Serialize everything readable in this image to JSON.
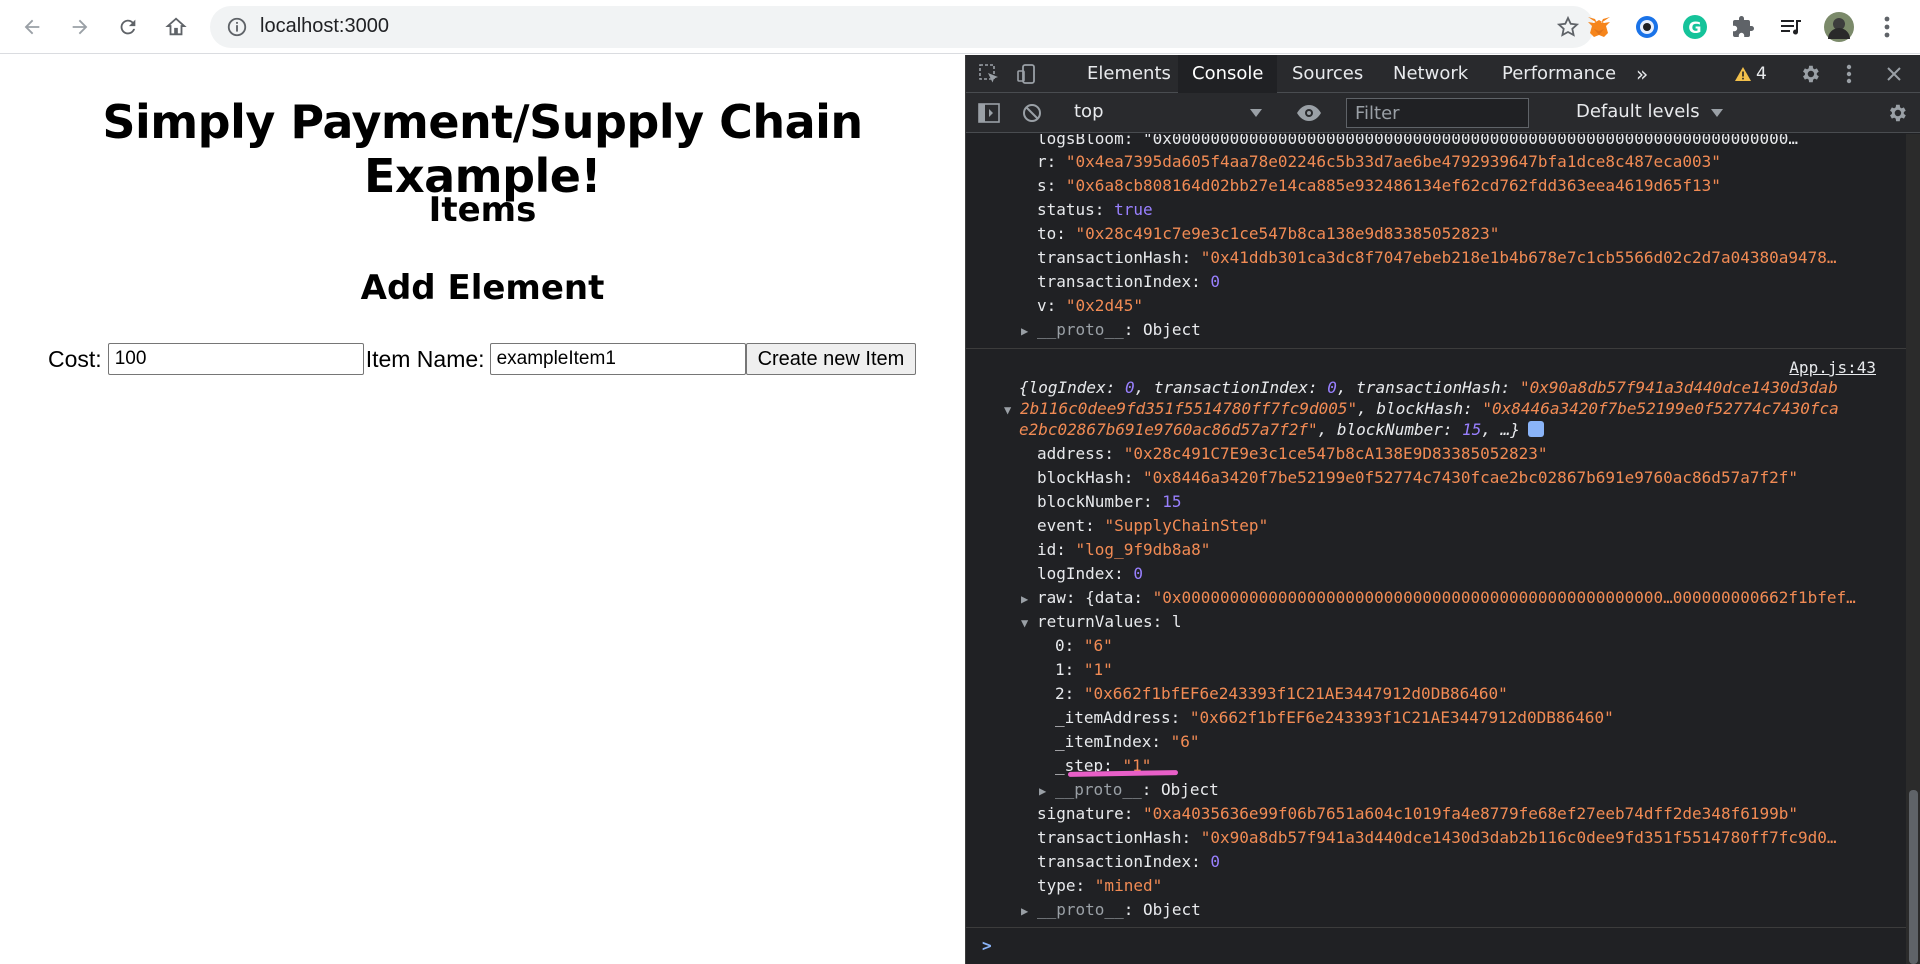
{
  "browser": {
    "url": "localhost:3000"
  },
  "page": {
    "title": "Simply Payment/Supply Chain Example!",
    "items_heading": "Items",
    "add_heading": "Add Element",
    "cost_label": "Cost:",
    "cost_value": "100",
    "item_name_label": "Item Name:",
    "item_name_value": "exampleItem1",
    "create_button": "Create new Item"
  },
  "devtools": {
    "tabs": [
      "Elements",
      "Console",
      "Sources",
      "Network",
      "Performance"
    ],
    "more_tabs": "»",
    "warning_count": "4",
    "context": "top",
    "filter_placeholder": "Filter",
    "levels": "Default levels",
    "source_link": "App.js:43",
    "prompt": ">"
  },
  "console": {
    "prev": {
      "logsBloom": "logsBloom: \"0x0000000000000000000000000000000000000000000000000000000000000000…",
      "r_key": "r: ",
      "r_val": "\"0x4ea7395da605f4aa78e02246c5b33d7ae6be4792939647bfa1dce8c487eca003\"",
      "s_key": "s: ",
      "s_val": "\"0x6a8cb808164d02bb27e14ca885e932486134ef62cd762fdd363eea4619d65f13\"",
      "status_key": "status: ",
      "status_val": "true",
      "to_key": "to: ",
      "to_val": "\"0x28c491c7e9e3c1ce547b8ca138e9d83385052823\"",
      "th_key": "transactionHash: ",
      "th_val": "\"0x41ddb301ca3dc8f7047ebeb218e1b4b678e7c1cb5566d02c2d7a04380a9478…",
      "ti_key": "transactionIndex: ",
      "ti_val": "0",
      "v_key": "v: ",
      "v_val": "\"0x2d45\"",
      "proto_key": "__proto__",
      "proto_val": ": Object"
    },
    "summary": {
      "l1_a": "{logIndex: ",
      "l1_b": "0",
      "l1_c": ", transactionIndex: ",
      "l1_d": "0",
      "l1_e": ", transactionHash: ",
      "l1_f": "\"0x90a8db57f941a3d440dce1430d3dab",
      "l2_a": "2b116c0dee9fd351f5514780ff7fc9d005\"",
      "l2_b": ", blockHash: ",
      "l2_c": "\"0x8446a3420f7be52199e0f52774c7430fca",
      "l3_a": "e2bc02867b691e9760ac86d57a7f2f\"",
      "l3_b": ", blockNumber: ",
      "l3_c": "15",
      "l3_d": ", …}"
    },
    "entry": {
      "address_key": "address: ",
      "address_val": "\"0x28c491C7E9e3c1ce547b8cA138E9D83385052823\"",
      "blockHash_key": "blockHash: ",
      "blockHash_val": "\"0x8446a3420f7be52199e0f52774c7430fcae2bc02867b691e9760ac86d57a7f2f\"",
      "blockNumber_key": "blockNumber: ",
      "blockNumber_val": "15",
      "event_key": "event: ",
      "event_val": "\"SupplyChainStep\"",
      "id_key": "id: ",
      "id_val": "\"log_9f9db8a8\"",
      "logIndex_key": "logIndex: ",
      "logIndex_val": "0",
      "raw_key": "raw: ",
      "raw_a": "{data: ",
      "raw_val": "\"0x00000000000000000000000000000000000000000000000000…000000000662f1bfef…",
      "rv_key": "returnValues: ",
      "rv_val": "l",
      "rv0_key": "0: ",
      "rv0_val": "\"6\"",
      "rv1_key": "1: ",
      "rv1_val": "\"1\"",
      "rv2_key": "2: ",
      "rv2_val": "\"0x662f1bfEF6e243393f1C21AE3447912d0DB86460\"",
      "ia_key": "_itemAddress: ",
      "ia_val": "\"0x662f1bfEF6e243393f1C21AE3447912d0DB86460\"",
      "ii_key": "_itemIndex: ",
      "ii_val": "\"6\"",
      "st_key": "_step: ",
      "st_val": "\"1\"",
      "rvproto_key": "__proto__",
      "rvproto_val": ": Object",
      "sig_key": "signature: ",
      "sig_val": "\"0xa4035636e99f06b7651a604c1019fa4e8779fe68ef27eeb74dff2de348f6199b\"",
      "th_key": "transactionHash: ",
      "th_val": "\"0x90a8db57f941a3d440dce1430d3dab2b116c0dee9fd351f5514780ff7fc9d0…",
      "ti_key": "transactionIndex: ",
      "ti_val": "0",
      "type_key": "type: ",
      "type_val": "\"mined\"",
      "proto_key": "__proto__",
      "proto_val": ": Object"
    }
  }
}
